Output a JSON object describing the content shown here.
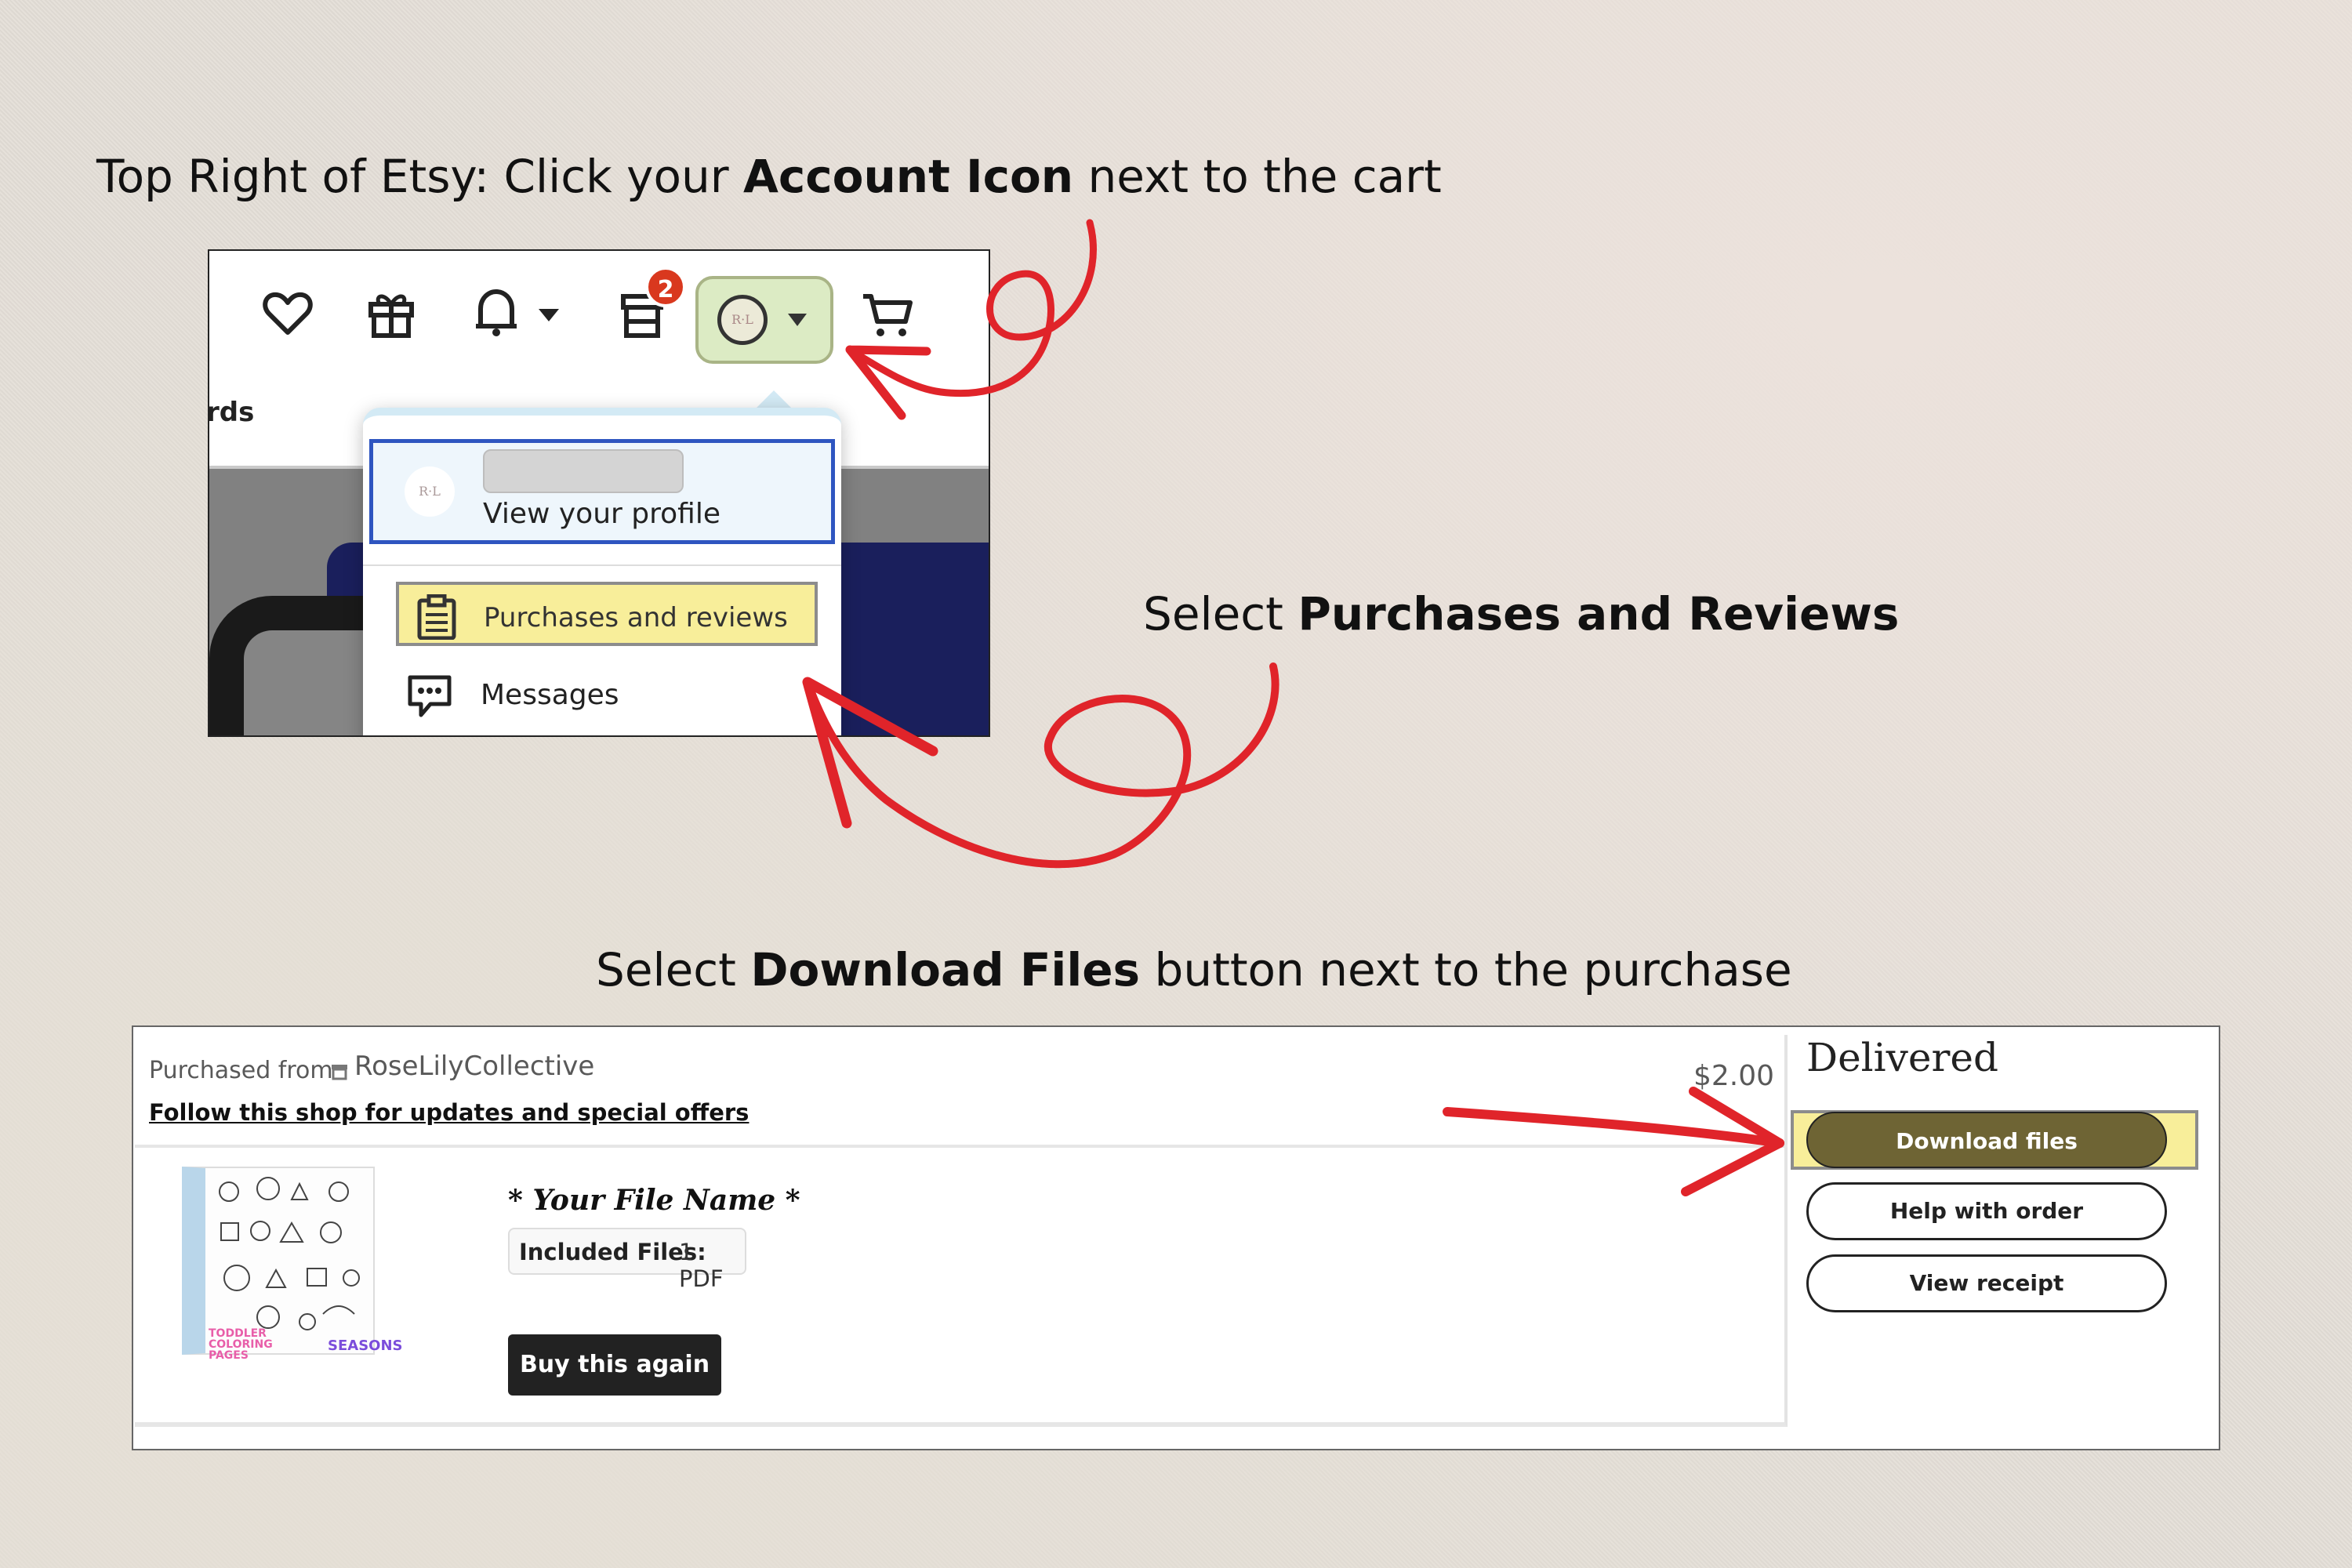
{
  "instructions": {
    "step1": {
      "before": "Top Right of Etsy: Click your ",
      "bold": "Account Icon",
      "after": " next to the cart"
    },
    "step2": {
      "before": "Select ",
      "bold": "Purchases and Reviews",
      "after": ""
    },
    "step3": {
      "before": "Select ",
      "bold": "Download Files",
      "after": " button next to the purchase"
    }
  },
  "etsy_header": {
    "notification_count": "2",
    "cut_text": "rds",
    "icons": [
      "heart-icon",
      "gift-icon",
      "bell-icon",
      "shop-icon",
      "account-icon",
      "cart-icon"
    ]
  },
  "account_menu": {
    "profile_label": "View your profile",
    "items": [
      {
        "label": "Purchases and reviews",
        "icon": "clipboard-icon",
        "highlighted": true
      },
      {
        "label": "Messages",
        "icon": "message-icon",
        "highlighted": false
      }
    ]
  },
  "purchase": {
    "purchased_from_label": "Purchased from",
    "shop_name": "RoseLilyCollective",
    "follow_text": "Follow this shop for updates and special offers",
    "price": "$2.00",
    "file_name": "* Your File Name *",
    "included_label": "Included Files:",
    "included_value": "1 PDF",
    "buy_again_label": "Buy this again",
    "thumb_text_left": "TODDLER COLORING PAGES",
    "thumb_text_right": "SEASONS"
  },
  "order_status": {
    "status": "Delivered",
    "download_label": "Download files",
    "help_label": "Help with order",
    "receipt_label": "View receipt"
  },
  "colors": {
    "highlight": "#f8ee9a",
    "annotation_red": "#e0242a",
    "download_button": "#6e6434",
    "profile_border": "#2e55c0"
  }
}
